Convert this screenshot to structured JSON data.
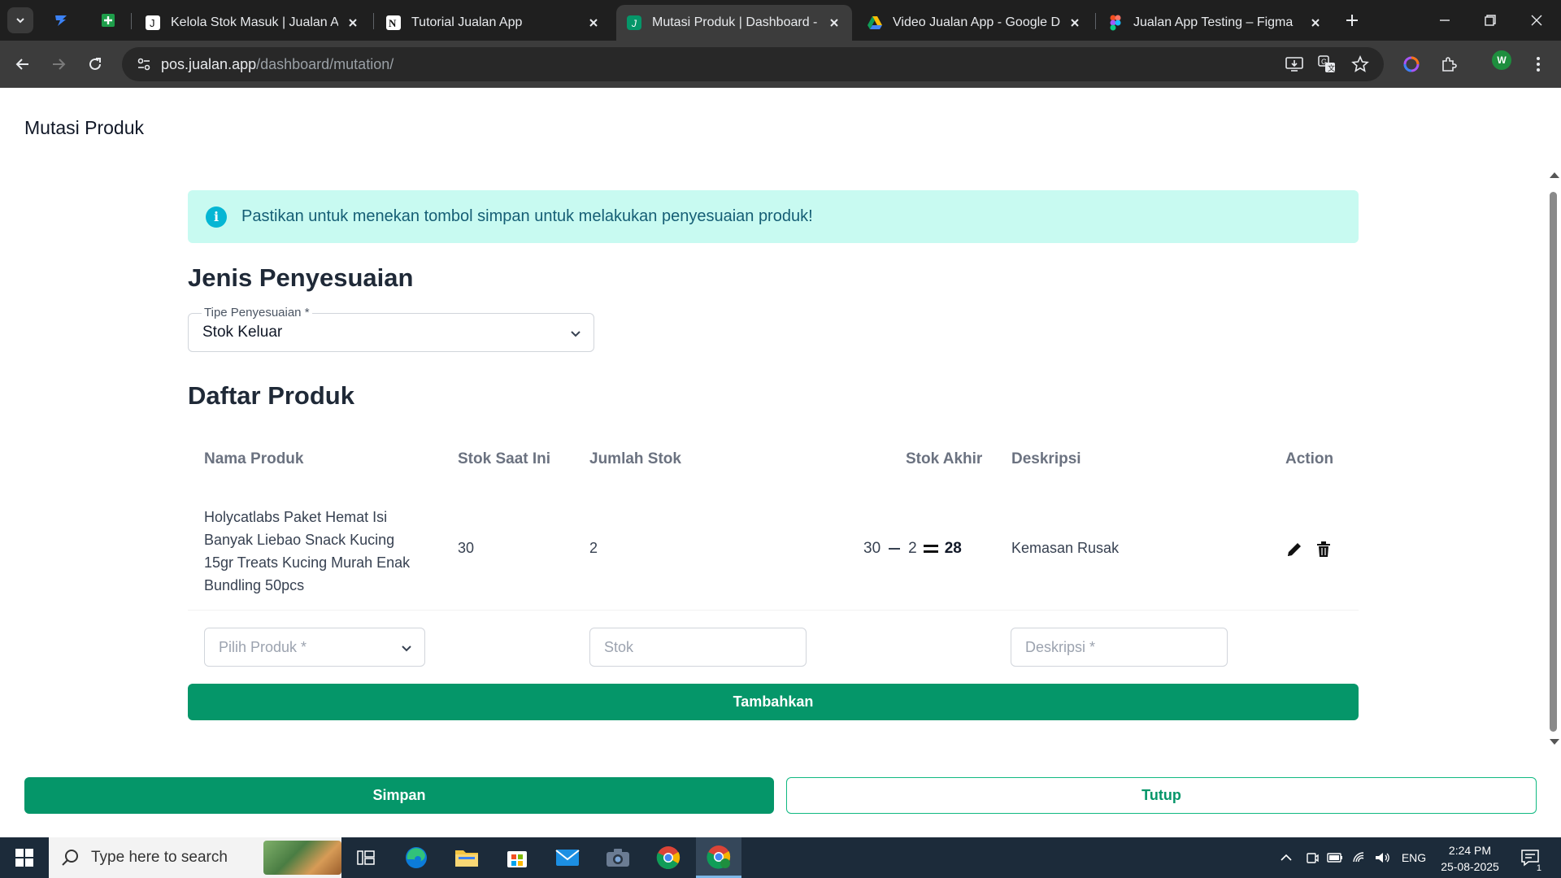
{
  "browser": {
    "tabs": [
      {
        "title": "Kelola Stok Masuk | Jualan App",
        "active": false
      },
      {
        "title": "Tutorial Jualan App",
        "active": false
      },
      {
        "title": "Mutasi Produk | Dashboard - Ju",
        "active": true
      },
      {
        "title": "Video Jualan App - Google Driv",
        "active": false
      },
      {
        "title": "Jualan App Testing – Figma",
        "active": false
      }
    ],
    "url_host": "pos.jualan.app",
    "url_path": "/dashboard/mutation/",
    "profile_initial": "W"
  },
  "page": {
    "title": "Mutasi Produk",
    "alert": "Pastikan untuk menekan tombol simpan untuk melakukan penyesuaian produk!",
    "adjustment_section": "Jenis Penyesuaian",
    "adjustment_type": {
      "label": "Tipe Penyesuaian *",
      "value": "Stok Keluar"
    },
    "product_section": "Daftar Produk",
    "table": {
      "headers": {
        "name": "Nama Produk",
        "current_stock": "Stok Saat Ini",
        "qty": "Jumlah Stok",
        "final_stock": "Stok Akhir",
        "description": "Deskripsi",
        "action": "Action"
      },
      "rows": [
        {
          "name": "Holycatlabs Paket Hemat Isi Banyak Liebao Snack Kucing 15gr Treats Kucing Murah Enak Bundling 50pcs",
          "current_stock": "30",
          "qty": "2",
          "calc_start": "30",
          "calc_qty": "2",
          "final_stock": "28",
          "description": "Kemasan Rusak"
        }
      ]
    },
    "new_row": {
      "product_placeholder": "Pilih Produk *",
      "stock_placeholder": "Stok",
      "description_placeholder": "Deskripsi *"
    },
    "add_button": "Tambahkan",
    "save_button": "Simpan",
    "close_button": "Tutup"
  },
  "taskbar": {
    "search_placeholder": "Type here to search",
    "language": "ENG",
    "time": "2:24 PM",
    "date": "25-08-2025",
    "notification_count": "1"
  },
  "colors": {
    "primary": "#059669",
    "alert_bg": "#c8faf1",
    "alert_text": "#155e75",
    "info": "#06b6d4"
  }
}
